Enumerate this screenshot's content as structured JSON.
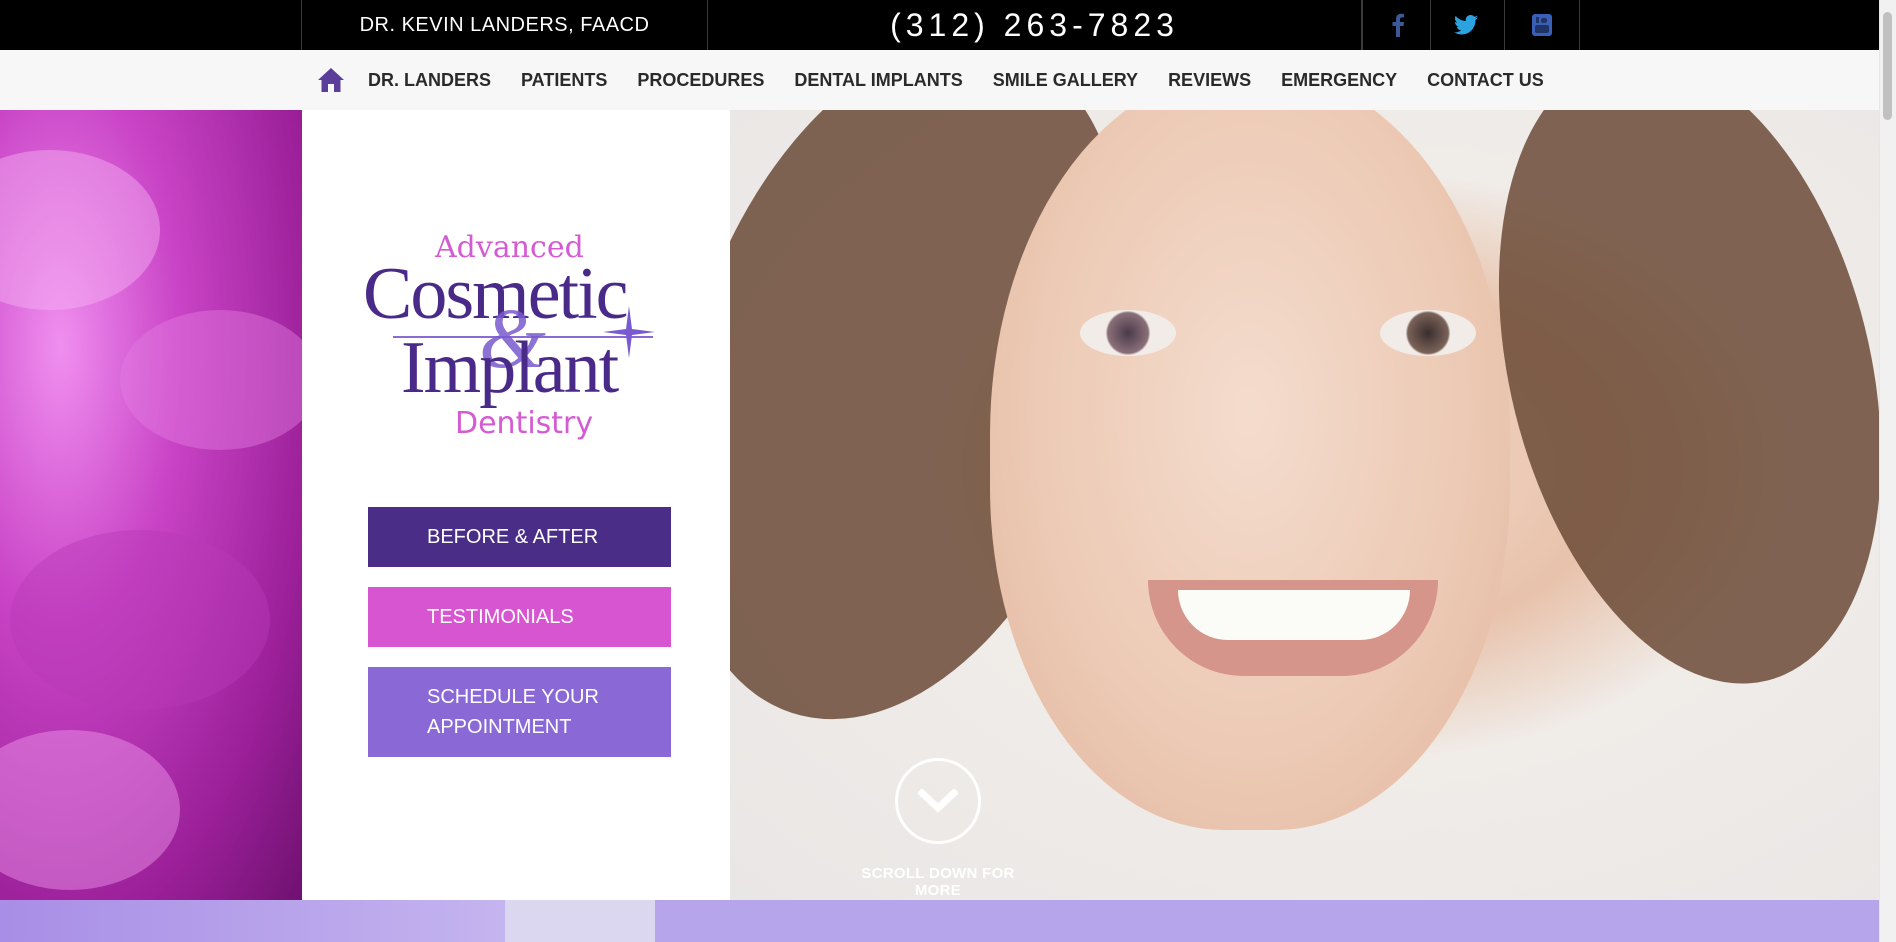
{
  "topbar": {
    "doctor": "DR. KEVIN LANDERS, FAACD",
    "phone": "(312) 263-7823",
    "social": [
      "facebook-icon",
      "twitter-icon",
      "youtube-icon"
    ]
  },
  "nav": {
    "home_icon": "home-icon",
    "items": [
      "DR. LANDERS",
      "PATIENTS",
      "PROCEDURES",
      "DENTAL IMPLANTS",
      "SMILE GALLERY",
      "REVIEWS",
      "EMERGENCY",
      "CONTACT US"
    ]
  },
  "logo": {
    "line1": "Advanced",
    "line2": "Cosmetic",
    "line3": "&",
    "line4": "Implant",
    "line5": "Dentistry"
  },
  "cta": {
    "before_after": "BEFORE & AFTER",
    "testimonials": "TESTIMONIALS",
    "schedule_line1": "SCHEDULE YOUR",
    "schedule_line2": "APPOINTMENT"
  },
  "scroll": {
    "label": "SCROLL DOWN FOR MORE"
  },
  "colors": {
    "purple_dark": "#4a2d86",
    "pink": "#d755d0",
    "purple_light": "#8a69d7",
    "nav_icon": "#5b3e99"
  }
}
